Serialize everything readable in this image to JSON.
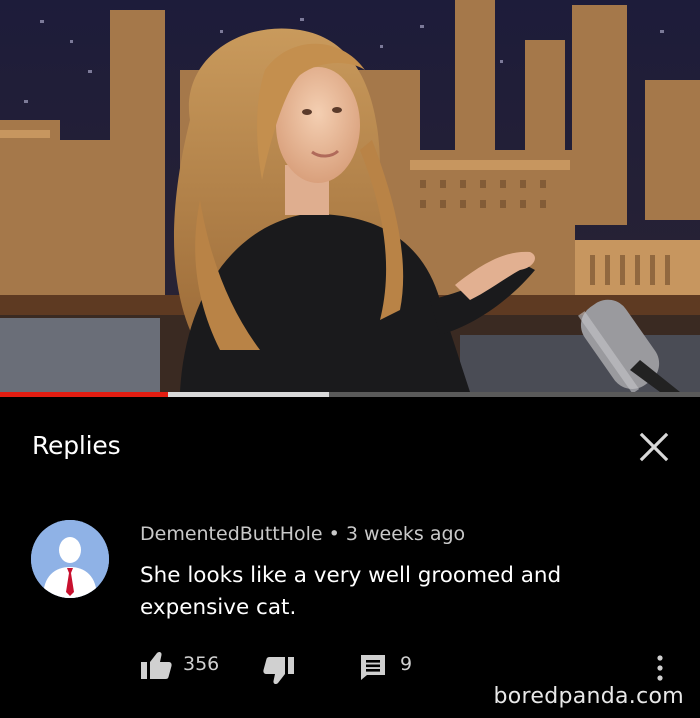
{
  "video": {
    "played_fraction": 0.24,
    "buffered_fraction": 0.47
  },
  "panel": {
    "title": "Replies"
  },
  "comment": {
    "author": "DementedButtHole",
    "separator": "•",
    "time": "3 weeks ago",
    "text": "She looks like a very well groomed and expensive cat.",
    "likes": "356",
    "replies": "9"
  },
  "watermark": "boredpanda.com",
  "icons": {
    "close": "close-icon",
    "like": "thumbs-up-icon",
    "dislike": "thumbs-down-icon",
    "reply": "reply-icon",
    "more": "more-vertical-icon",
    "avatar": "default-avatar-icon"
  },
  "colors": {
    "background": "#000000",
    "progress_played": "#e21d12",
    "progress_buffered": "#d9d9d9",
    "avatar_bg": "#8fb2e6"
  }
}
